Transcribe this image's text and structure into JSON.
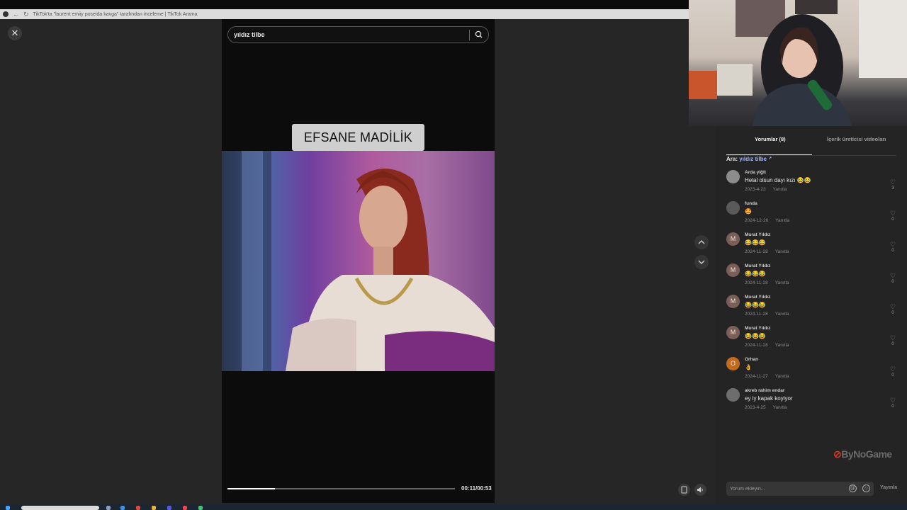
{
  "browser": {
    "tab_title": "TikTok'ta \"laurent emiiy poseida kavga\" tarafından inceleme | TikTok Arama"
  },
  "player": {
    "search_query": "yıldız tilbe",
    "caption": "EFSANE MADİLİK",
    "progress": 0.21,
    "time": "00:11/00:53"
  },
  "panel": {
    "tabs": [
      {
        "label": "Yorumlar (8)"
      },
      {
        "label": "İçerik üreticisi videoları"
      }
    ],
    "related_label": "Ara:",
    "related_query": "yıldız tilbe"
  },
  "comments": [
    {
      "user": "Arda yiğit",
      "text": "Helal olsun dayı kızı 😂😂",
      "date": "2023-4-23",
      "reply": "Yanıtla",
      "likes": "3",
      "avatar_letter": "",
      "avatar_color": "#8c8c8c"
    },
    {
      "user": "funda",
      "text": "🤩",
      "date": "2024-12-26",
      "reply": "Yanıtla",
      "likes": "0",
      "avatar_letter": "",
      "avatar_color": "#5a5a5a"
    },
    {
      "user": "Murat Yıldız",
      "text": "😂😂😂",
      "date": "2024-11-28",
      "reply": "Yanıtla",
      "likes": "0",
      "avatar_letter": "M",
      "avatar_color": "#7a5e58"
    },
    {
      "user": "Murat Yıldız",
      "text": "😂😂😂",
      "date": "2024-11-28",
      "reply": "Yanıtla",
      "likes": "0",
      "avatar_letter": "M",
      "avatar_color": "#7a5e58"
    },
    {
      "user": "Murat Yıldız",
      "text": "😂😂😂",
      "date": "2024-11-28",
      "reply": "Yanıtla",
      "likes": "0",
      "avatar_letter": "M",
      "avatar_color": "#7a5e58"
    },
    {
      "user": "Murat Yıldız",
      "text": "😂😂😂",
      "date": "2024-11-28",
      "reply": "Yanıtla",
      "likes": "0",
      "avatar_letter": "M",
      "avatar_color": "#7a5e58"
    },
    {
      "user": "Orhan",
      "text": "👌",
      "date": "2024-11-27",
      "reply": "Yanıtla",
      "likes": "0",
      "avatar_letter": "O",
      "avatar_color": "#c26a1e"
    },
    {
      "user": "akreb rahim endar",
      "text": "ey iy kapak koyiyor",
      "date": "2023-4-25",
      "reply": "Yanıtla",
      "likes": "0",
      "avatar_letter": "",
      "avatar_color": "#6d6d6d"
    }
  ],
  "composer": {
    "placeholder": "Yorum ekleyin...",
    "post_label": "Yayınla"
  },
  "brand": {
    "name": "ByNoGame"
  },
  "colors": {
    "accent": "#d9361c",
    "link": "#9fb3ff",
    "background": "#242424"
  }
}
